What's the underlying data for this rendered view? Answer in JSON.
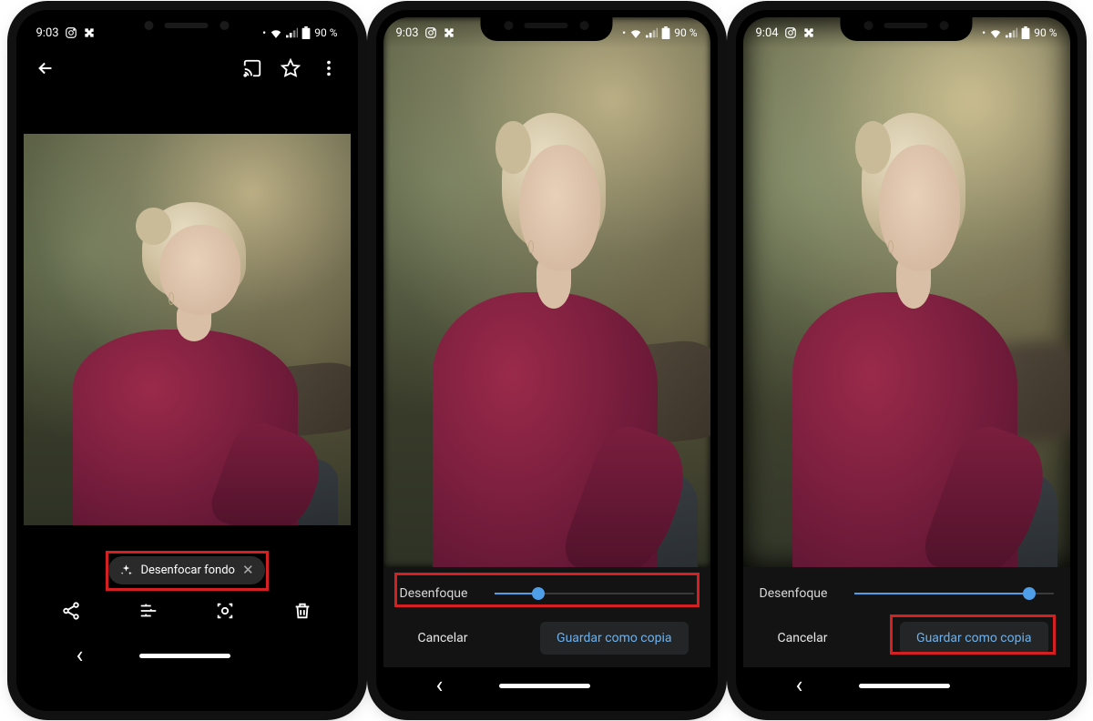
{
  "status": {
    "time1": "9:03",
    "time2": "9:03",
    "time3": "9:04",
    "battery": "90 %"
  },
  "phone1": {
    "chipLabel": "Desenfocar fondo"
  },
  "phone2": {
    "sliderLabel": "Desenfoque",
    "sliderValue": 22,
    "cancel": "Cancelar",
    "save": "Guardar como copia"
  },
  "phone3": {
    "sliderLabel": "Desenfoque",
    "sliderValue": 88,
    "cancel": "Cancelar",
    "save": "Guardar como copia"
  }
}
